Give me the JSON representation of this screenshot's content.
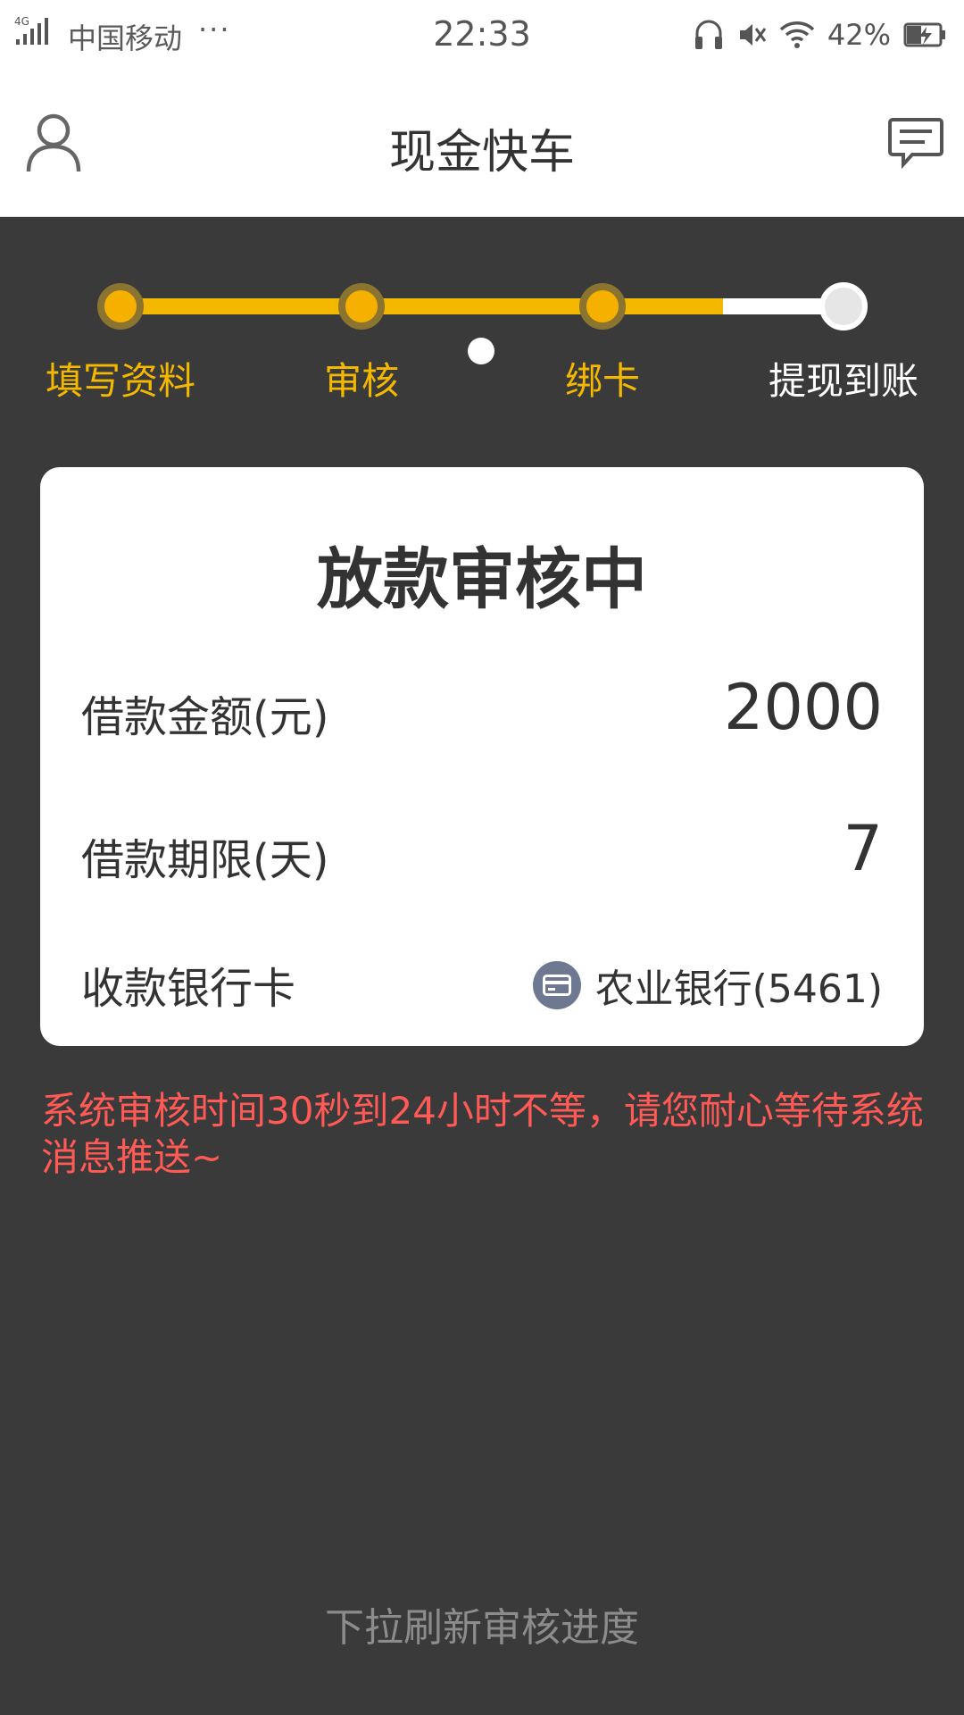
{
  "status_bar": {
    "carrier": "中国移动",
    "more": "···",
    "time": "22:33",
    "battery": "42%",
    "icons": [
      "signal-4g-icon",
      "headphones-icon",
      "mute-icon",
      "wifi-icon",
      "battery-charging-icon"
    ]
  },
  "header": {
    "title": "现金快车",
    "left_icon": "user-icon",
    "right_icon": "message-icon"
  },
  "stepper": {
    "steps": [
      {
        "label": "填写资料",
        "state": "done"
      },
      {
        "label": "审核",
        "state": "done"
      },
      {
        "label": "绑卡",
        "state": "done"
      },
      {
        "label": "提现到账",
        "state": "pending"
      }
    ],
    "colors": {
      "active": "#f5b800",
      "pending": "#ffffff"
    }
  },
  "card": {
    "title": "放款审核中",
    "amount_label": "借款金额(元)",
    "amount_value": "2000",
    "term_label": "借款期限(天)",
    "term_value": "7",
    "bank_label": "收款银行卡",
    "bank_value": "农业银行(5461)",
    "bank_icon": "bank-card-icon"
  },
  "notice": "系统审核时间30秒到24小时不等，请您耐心等待系统消息推送~",
  "pull_hint": "下拉刷新审核进度"
}
